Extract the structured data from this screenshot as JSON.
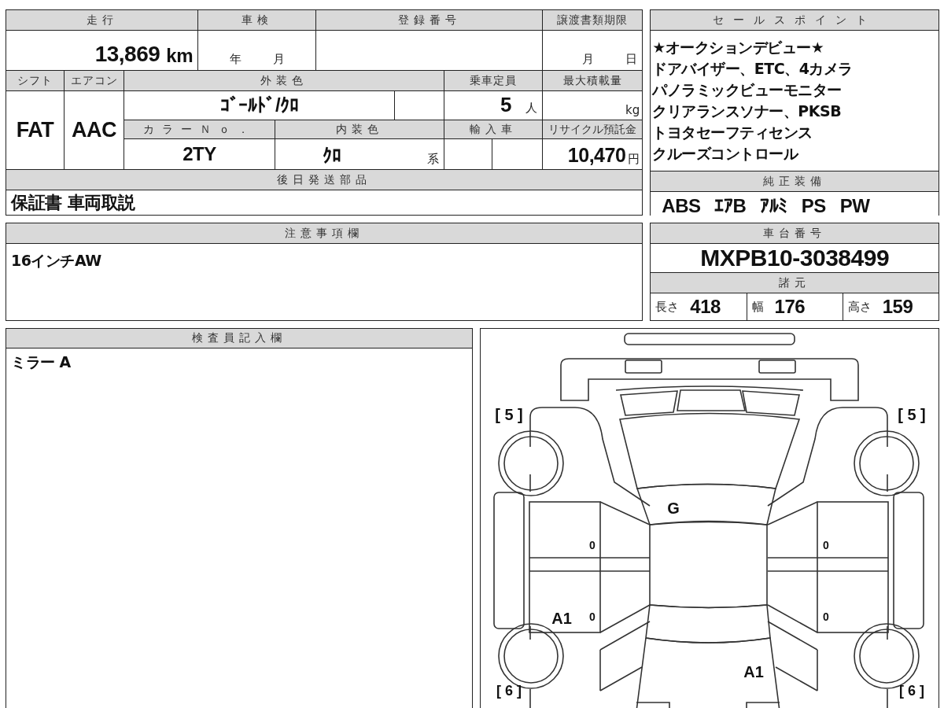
{
  "mileage": {
    "label": "走行",
    "value": "13,869",
    "unit": "km"
  },
  "inspection": {
    "label": "車検",
    "year_unit": "年",
    "month_unit": "月"
  },
  "registration_number": {
    "label": "登録番号"
  },
  "transfer_document_deadline": {
    "label": "譲渡書類期限",
    "month_unit": "月",
    "day_unit": "日"
  },
  "shift": {
    "label": "シフト",
    "value": "FAT"
  },
  "aircon": {
    "label": "エアコン",
    "value": "AAC"
  },
  "exterior_color": {
    "label": "外装色",
    "value": "ｺﾞｰﾙﾄﾞ/ｸﾛ"
  },
  "capacity": {
    "label": "乗車定員",
    "value": "5",
    "unit": "人"
  },
  "max_load": {
    "label": "最大積載量",
    "unit": "kg"
  },
  "color_number": {
    "label": "カラーＮｏ．",
    "value": "2TY"
  },
  "interior_color": {
    "label": "内装色",
    "value": "ｸﾛ",
    "suffix": "系"
  },
  "import": {
    "label": "輸入車"
  },
  "recycle_deposit": {
    "label": "リサイクル預託金",
    "value": "10,470",
    "unit": "円"
  },
  "later_shipped_parts": {
    "label": "後日発送部品",
    "value": "保証書 車両取説"
  },
  "sales_points": {
    "label": "セールスポイント",
    "lines": [
      "★オークションデビュー★",
      "ドアバイザー、ETC、4カメラ",
      "パノラミックビューモニター",
      "クリアランスソナー、PKSB",
      "トヨタセーフティセンス",
      "クルーズコントロール"
    ]
  },
  "standard_equipment": {
    "label": "純正装備",
    "items": [
      "ABS",
      "ｴｱB",
      "ｱﾙﾐ",
      "PS",
      "PW"
    ]
  },
  "notes": {
    "label": "注意事項欄",
    "text": "16インチAW"
  },
  "chassis_number": {
    "label": "車台番号",
    "value": "MXPB10-3038499"
  },
  "specifications": {
    "label": "諸元",
    "items": [
      {
        "label": "長さ",
        "value": "418"
      },
      {
        "label": "幅",
        "value": "176"
      },
      {
        "label": "高さ",
        "value": "159"
      }
    ]
  },
  "inspector_notes": {
    "label": "検査員記入欄",
    "text": "ミラー A"
  },
  "damage_diagram": {
    "marks": [
      {
        "kind": "front_left_tire",
        "text": "[ 5 ]"
      },
      {
        "kind": "front_right_tire",
        "text": "[ 5 ]"
      },
      {
        "kind": "hood",
        "text": "G"
      },
      {
        "kind": "left_front_door",
        "text": "0"
      },
      {
        "kind": "right_front_door",
        "text": "0"
      },
      {
        "kind": "left_rear_quarter",
        "text": "A1"
      },
      {
        "kind": "left_rear_door",
        "text": "0"
      },
      {
        "kind": "right_rear_door",
        "text": "0"
      },
      {
        "kind": "rear",
        "text": "A1"
      },
      {
        "kind": "rear_left_tire",
        "text": "[ 6 ]"
      },
      {
        "kind": "rear_right_tire",
        "text": "[ 6 ]"
      }
    ]
  }
}
